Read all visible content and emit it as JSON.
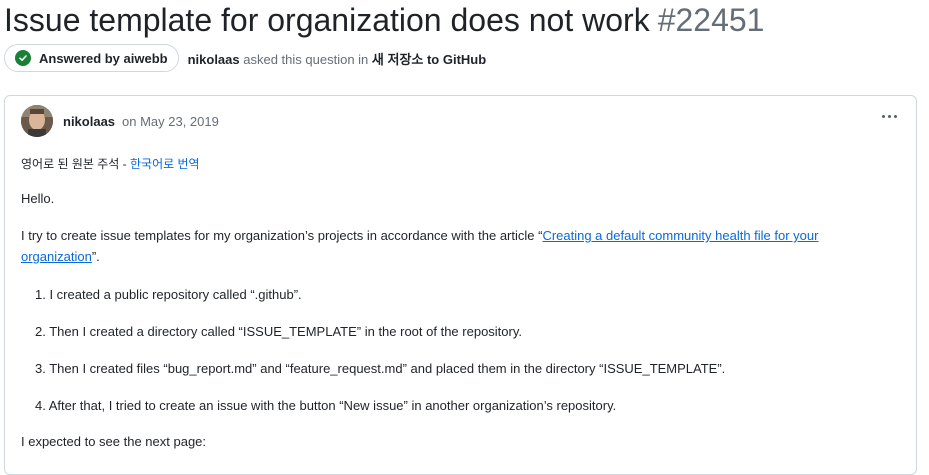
{
  "discussion": {
    "title": "Issue template for organization does not work",
    "number": "#22451",
    "answered_badge": "Answered by aiwebb",
    "asker": "nikolaas",
    "asked_text": "asked this question in",
    "category": "새 저장소 to GitHub"
  },
  "post": {
    "author": "nikolaas",
    "date": "on May 23, 2019",
    "translate_prefix": "영어로 된 원본 주석 - ",
    "translate_link": "한국어로 번역",
    "greeting": "Hello.",
    "intro_before": "I try to create issue templates for my organization’s projects in accordance with the article “",
    "intro_link_1": "Creating a default community health file for your",
    "intro_link_2": "organization",
    "intro_after": "”.",
    "steps": [
      "1. I created a public repository called “.github”.",
      "2. Then I created a directory called “ISSUE_TEMPLATE” in the root of the repository.",
      "3. Then I created files “bug_report.md” and “feature_request.md” and placed them in the directory “ISSUE_TEMPLATE”.",
      "4. After that, I tried to create an issue with the button “New issue” in another organization’s repository."
    ],
    "expected": "I expected to see the next page:"
  },
  "icons": {
    "badge_icon": "check-circle-icon",
    "menu_icon": "kebab-menu-icon"
  },
  "colors": {
    "link": "#0969da",
    "answered_green": "#1a7f37",
    "muted": "#656d76"
  }
}
